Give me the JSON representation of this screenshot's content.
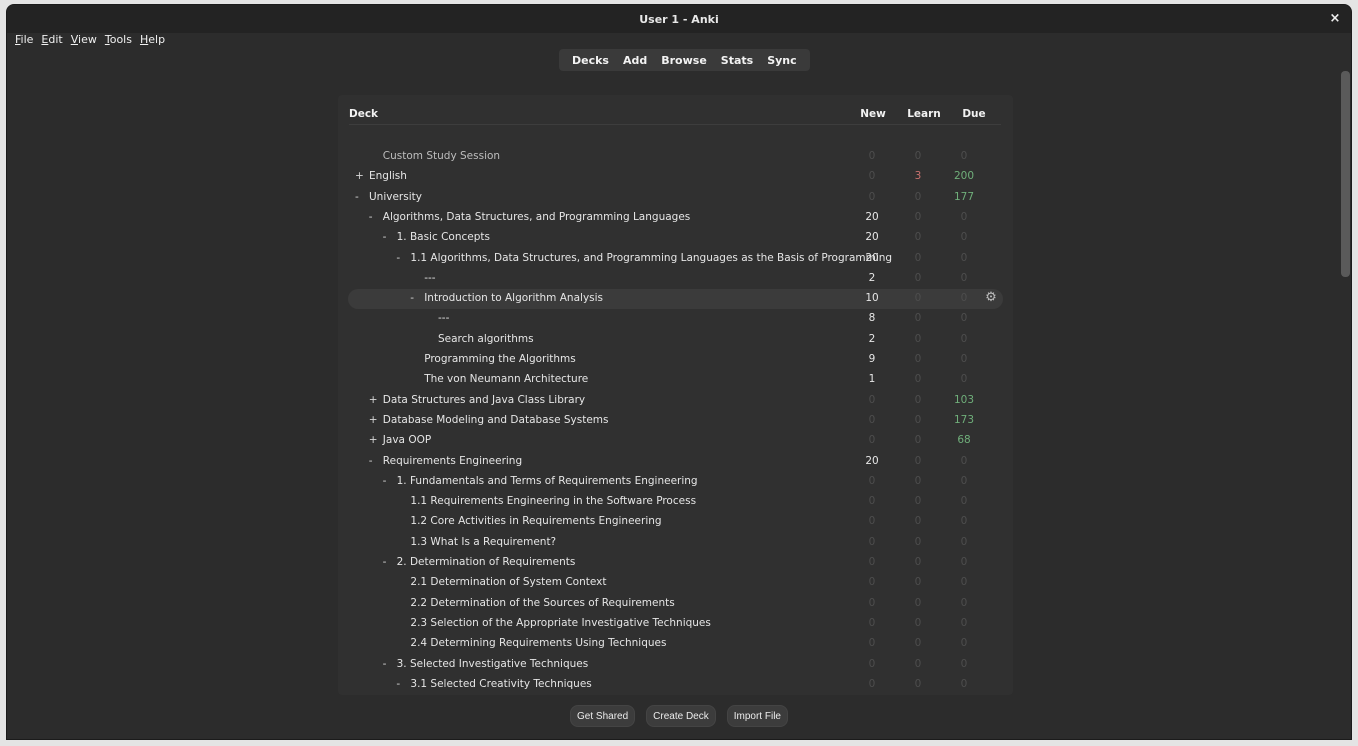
{
  "window": {
    "title": "User 1 - Anki",
    "close_glyph": "×"
  },
  "menu": [
    {
      "key": "F",
      "rest": "ile"
    },
    {
      "key": "E",
      "rest": "dit"
    },
    {
      "key": "V",
      "rest": "iew"
    },
    {
      "key": "T",
      "rest": "ools"
    },
    {
      "key": "H",
      "rest": "elp"
    }
  ],
  "toolbar": [
    "Decks",
    "Add",
    "Browse",
    "Stats",
    "Sync"
  ],
  "table_header": {
    "deck": "Deck",
    "new": "New",
    "learn": "Learn",
    "due": "Due"
  },
  "decks": [
    {
      "indent": 1,
      "toggle": "",
      "name": "Custom Study Session",
      "new": "0",
      "learn": "0",
      "due": "0",
      "muted": true
    },
    {
      "indent": 0,
      "toggle": "+",
      "name": "English",
      "new": "0",
      "learn": "3",
      "due": "200"
    },
    {
      "indent": 0,
      "toggle": "-",
      "name": "University",
      "new": "0",
      "learn": "0",
      "due": "177"
    },
    {
      "indent": 1,
      "toggle": "-",
      "name": "Algorithms, Data Structures, and Programming Languages",
      "new": "20",
      "learn": "0",
      "due": "0"
    },
    {
      "indent": 2,
      "toggle": "-",
      "name": "1. Basic Concepts",
      "new": "20",
      "learn": "0",
      "due": "0"
    },
    {
      "indent": 3,
      "toggle": "-",
      "name": "1.1 Algorithms, Data Structures, and Programming Languages as the Basis of Programming",
      "new": "20",
      "learn": "0",
      "due": "0"
    },
    {
      "indent": 4,
      "toggle": "",
      "name": "---",
      "new": "2",
      "learn": "0",
      "due": "0"
    },
    {
      "indent": 4,
      "toggle": "-",
      "name": "Introduction to Algorithm Analysis",
      "new": "10",
      "learn": "0",
      "due": "0",
      "current": true
    },
    {
      "indent": 5,
      "toggle": "",
      "name": "---",
      "new": "8",
      "learn": "0",
      "due": "0"
    },
    {
      "indent": 5,
      "toggle": "",
      "name": "Search algorithms",
      "new": "2",
      "learn": "0",
      "due": "0"
    },
    {
      "indent": 4,
      "toggle": "",
      "name": "Programming the Algorithms",
      "new": "9",
      "learn": "0",
      "due": "0"
    },
    {
      "indent": 4,
      "toggle": "",
      "name": "The von Neumann Architecture",
      "new": "1",
      "learn": "0",
      "due": "0"
    },
    {
      "indent": 1,
      "toggle": "+",
      "name": "Data Structures and Java Class Library",
      "new": "0",
      "learn": "0",
      "due": "103"
    },
    {
      "indent": 1,
      "toggle": "+",
      "name": "Database Modeling and Database Systems",
      "new": "0",
      "learn": "0",
      "due": "173"
    },
    {
      "indent": 1,
      "toggle": "+",
      "name": "Java OOP",
      "new": "0",
      "learn": "0",
      "due": "68"
    },
    {
      "indent": 1,
      "toggle": "-",
      "name": "Requirements Engineering",
      "new": "20",
      "learn": "0",
      "due": "0"
    },
    {
      "indent": 2,
      "toggle": "-",
      "name": "1. Fundamentals and Terms of Requirements Engineering",
      "new": "0",
      "learn": "0",
      "due": "0"
    },
    {
      "indent": 3,
      "toggle": "",
      "name": "1.1 Requirements Engineering in the Software Process",
      "new": "0",
      "learn": "0",
      "due": "0"
    },
    {
      "indent": 3,
      "toggle": "",
      "name": "1.2 Core Activities in Requirements Engineering",
      "new": "0",
      "learn": "0",
      "due": "0"
    },
    {
      "indent": 3,
      "toggle": "",
      "name": "1.3 What Is a Requirement?",
      "new": "0",
      "learn": "0",
      "due": "0"
    },
    {
      "indent": 2,
      "toggle": "-",
      "name": "2. Determination of Requirements",
      "new": "0",
      "learn": "0",
      "due": "0"
    },
    {
      "indent": 3,
      "toggle": "",
      "name": "2.1 Determination of System Context",
      "new": "0",
      "learn": "0",
      "due": "0"
    },
    {
      "indent": 3,
      "toggle": "",
      "name": "2.2 Determination of the Sources of Requirements",
      "new": "0",
      "learn": "0",
      "due": "0"
    },
    {
      "indent": 3,
      "toggle": "",
      "name": "2.3 Selection of the Appropriate Investigative Techniques",
      "new": "0",
      "learn": "0",
      "due": "0"
    },
    {
      "indent": 3,
      "toggle": "",
      "name": "2.4 Determining Requirements Using Techniques",
      "new": "0",
      "learn": "0",
      "due": "0"
    },
    {
      "indent": 2,
      "toggle": "-",
      "name": "3. Selected Investigative Techniques",
      "new": "0",
      "learn": "0",
      "due": "0"
    },
    {
      "indent": 3,
      "toggle": "-",
      "name": "3.1 Selected Creativity Techniques",
      "new": "0",
      "learn": "0",
      "due": "0"
    }
  ],
  "options_icon": "gear-icon",
  "bottom_buttons": [
    "Get Shared",
    "Create Deck",
    "Import File"
  ],
  "colors": {
    "due": "#6fae7a",
    "learn": "#c9726f",
    "zero": "#4d4d4d"
  }
}
